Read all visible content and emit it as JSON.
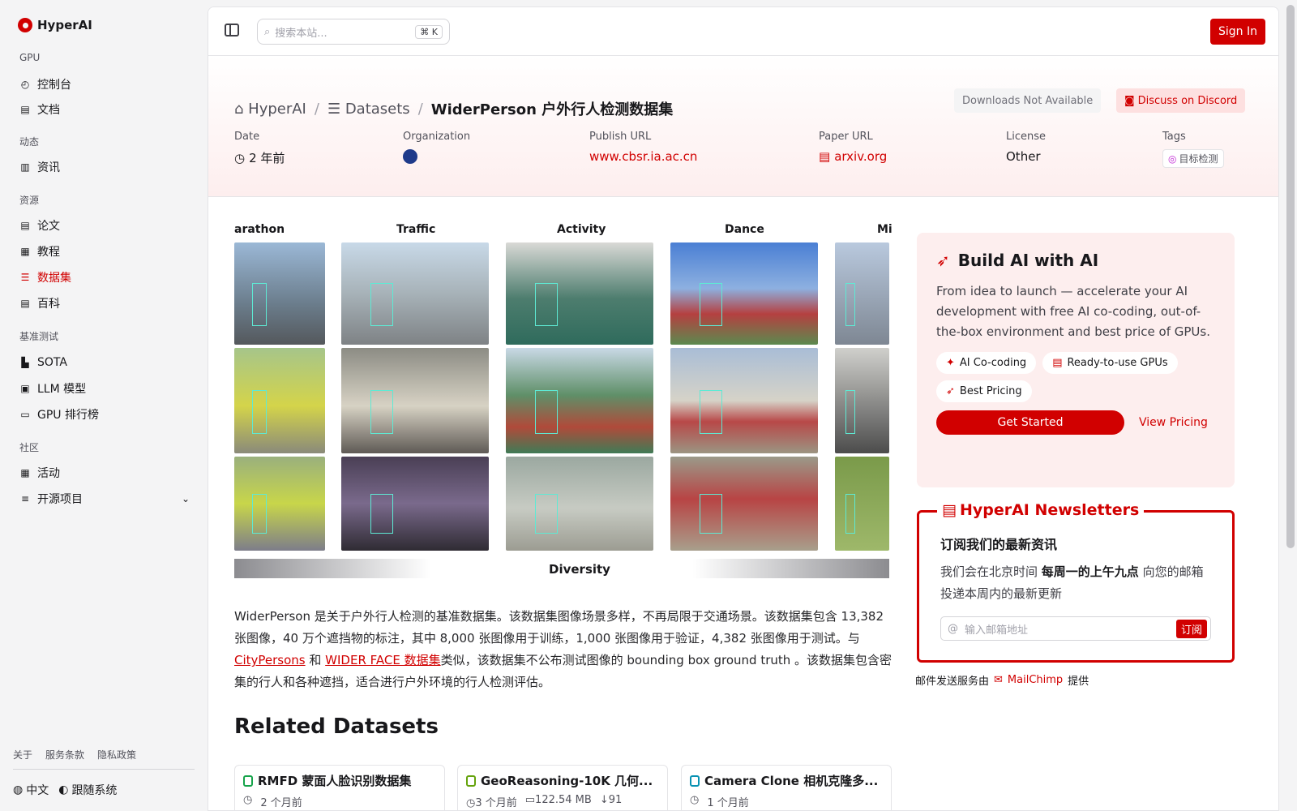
{
  "brand": "HyperAI",
  "sidebar": {
    "sections": [
      "GPU",
      "动态",
      "资源",
      "基准测试",
      "社区"
    ],
    "items": [
      {
        "label": "控制台",
        "icon": "gauge-icon"
      },
      {
        "label": "文档",
        "icon": "book-icon"
      },
      {
        "label": "资讯",
        "icon": "news-icon"
      },
      {
        "label": "论文",
        "icon": "paper-icon"
      },
      {
        "label": "教程",
        "icon": "notebook-icon"
      },
      {
        "label": "数据集",
        "icon": "database-icon"
      },
      {
        "label": "百科",
        "icon": "wiki-icon"
      },
      {
        "label": "SOTA",
        "icon": "chart-icon"
      },
      {
        "label": "LLM 模型",
        "icon": "chip-icon"
      },
      {
        "label": "GPU 排行榜",
        "icon": "monitor-icon"
      },
      {
        "label": "活动",
        "icon": "calendar-icon"
      },
      {
        "label": "开源项目",
        "icon": "list-icon"
      }
    ],
    "footer_links": [
      "关于",
      "服务条款",
      "隐私政策"
    ],
    "language": "中文",
    "theme": "跟随系统"
  },
  "topbar": {
    "search_placeholder": "搜索本站...",
    "shortcut": "⌘ K",
    "sign_in": "Sign In"
  },
  "breadcrumb": {
    "home": "HyperAI",
    "section": "Datasets",
    "current": "WiderPerson 户外行人检测数据集"
  },
  "actions": {
    "downloads": "Downloads Not Available",
    "discord": "Discuss on Discord"
  },
  "meta": {
    "date_label": "Date",
    "date_value": "2 年前",
    "org_label": "Organization",
    "publish_label": "Publish URL",
    "publish_value": "www.cbsr.ia.ac.cn",
    "paper_label": "Paper URL",
    "paper_value": "arxiv.org",
    "license_label": "License",
    "license_value": "Other",
    "tags_label": "Tags",
    "tag_value": "目标检测"
  },
  "figure": {
    "columns": [
      "arathon",
      "Traffic",
      "Activity",
      "Dance",
      "Mi"
    ],
    "footer": "Diversity"
  },
  "description": {
    "part1": "WiderPerson 是关于户外行人检测的基准数据集。该数据集图像场景多样，不再局限于交通场景。该数据集包含 13,382 张图像，40 万个遮挡物的标注，其中 8,000 张图像用于训练，1,000 张图像用于验证，4,382 张图像用于测试。与 ",
    "link1": "CityPersons",
    "part2": " 和 ",
    "link2": "WIDER FACE 数据集",
    "part3": "类似，该数据集不公布测试图像的 bounding box ground truth 。该数据集包含密集的行人和各种遮挡，适合进行户外环境的行人检测评估。"
  },
  "related": {
    "title": "Related Datasets",
    "cards": [
      {
        "title": "RMFD 蒙面人脸识别数据集",
        "time": "2 个月前",
        "size": "",
        "downloads": ""
      },
      {
        "title": "GeoReasoning-10K 几何...",
        "time": "3 个月前",
        "size": "122.54 MB",
        "downloads": "91"
      },
      {
        "title": "Camera Clone 相机克隆多...",
        "time": "1 个月前",
        "size": "",
        "downloads": ""
      }
    ]
  },
  "promo": {
    "title": "Build AI with AI",
    "body": "From idea to launch — accelerate your AI development with free AI co-coding, out-of-the-box environment and best price of GPUs.",
    "features": [
      "AI Co-coding",
      "Ready-to-use GPUs",
      "Best Pricing"
    ],
    "cta": "Get Started",
    "pricing": "View Pricing"
  },
  "newsletter": {
    "title": "HyperAI Newsletters",
    "heading": "订阅我们的最新资讯",
    "body_pre": "我们会在北京时间 ",
    "body_bold": "每周一的上午九点",
    "body_post": " 向您的邮箱投递本周内的最新更新",
    "placeholder": "输入邮箱地址",
    "subscribe": "订阅",
    "provider_pre": "邮件发送服务由",
    "provider": "MailChimp",
    "provider_post": "提供"
  },
  "colors": {
    "accent": "#d10000",
    "background": "#f4f4f5"
  }
}
